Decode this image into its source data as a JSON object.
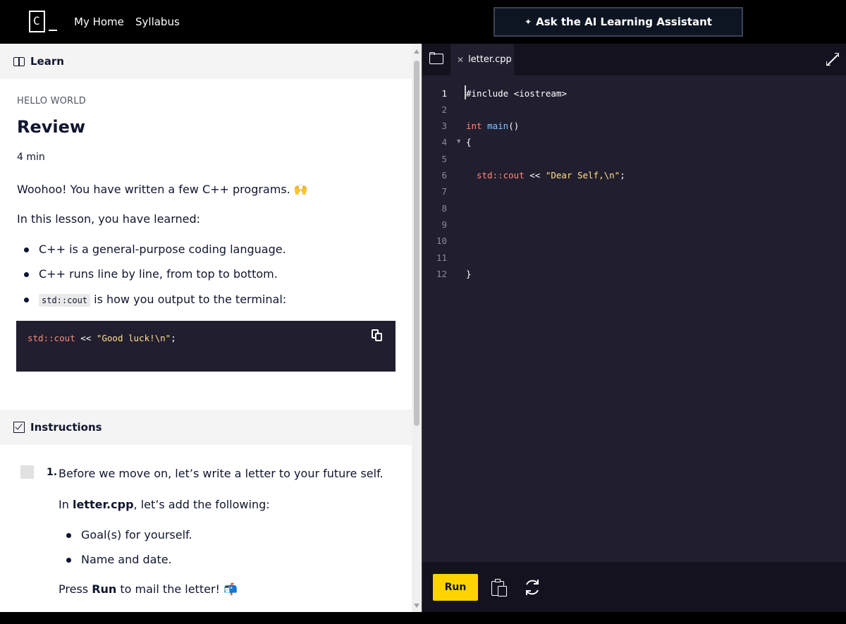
{
  "nav": {
    "logo_letter": "C",
    "links": [
      "My Home",
      "Syllabus"
    ],
    "ask_button": "Ask the AI Learning Assistant",
    "ask_icon": "sparkle-icon"
  },
  "learn": {
    "header": "Learn",
    "kicker": "HELLO WORLD",
    "title": "Review",
    "time": "4 min",
    "intro": "Woohoo! You have written a few C++ programs. 🙌",
    "learned_heading": "In this lesson, you have learned:",
    "bullets": [
      "C++ is a general-purpose coding language.",
      "C++ runs line by line, from top to bottom.",
      "is how you output to the terminal:"
    ],
    "bullet3_code": "std::cout",
    "code_example": {
      "t1": "std::cout",
      "t2": " << ",
      "t3": "\"Good luck!\\n\"",
      "t4": ";"
    }
  },
  "instructions": {
    "header": "Instructions",
    "task_number": "1.",
    "task_text": "Before we move on, let’s write a letter to your future self.",
    "in_prefix": "In ",
    "in_file": "letter.cpp",
    "in_suffix": ", let’s add the following:",
    "items": [
      "Goal(s) for yourself.",
      "Name and date."
    ],
    "press_prefix": "Press ",
    "press_run": "Run",
    "press_suffix": " to mail the letter! 📬"
  },
  "editor": {
    "tab_name": "letter.cpp",
    "line_numbers": [
      "1",
      "2",
      "3",
      "4",
      "5",
      "6",
      "7",
      "8",
      "9",
      "10",
      "11",
      "12"
    ],
    "l1": "#include <iostream>",
    "l3_kw": "int",
    "l3_fn": "main",
    "l3_rest": "()",
    "l4": "{",
    "l6_cout": "std::cout",
    "l6_op": " << ",
    "l6_str": "\"Dear Self,\\n\"",
    "l6_end": ";",
    "l12": "}",
    "run_label": "Run"
  },
  "colors": {
    "accent_yellow": "#ffd300",
    "editor_bg": "#211e2f",
    "token_red": "#ff8973",
    "token_yellow": "#ffe083"
  }
}
